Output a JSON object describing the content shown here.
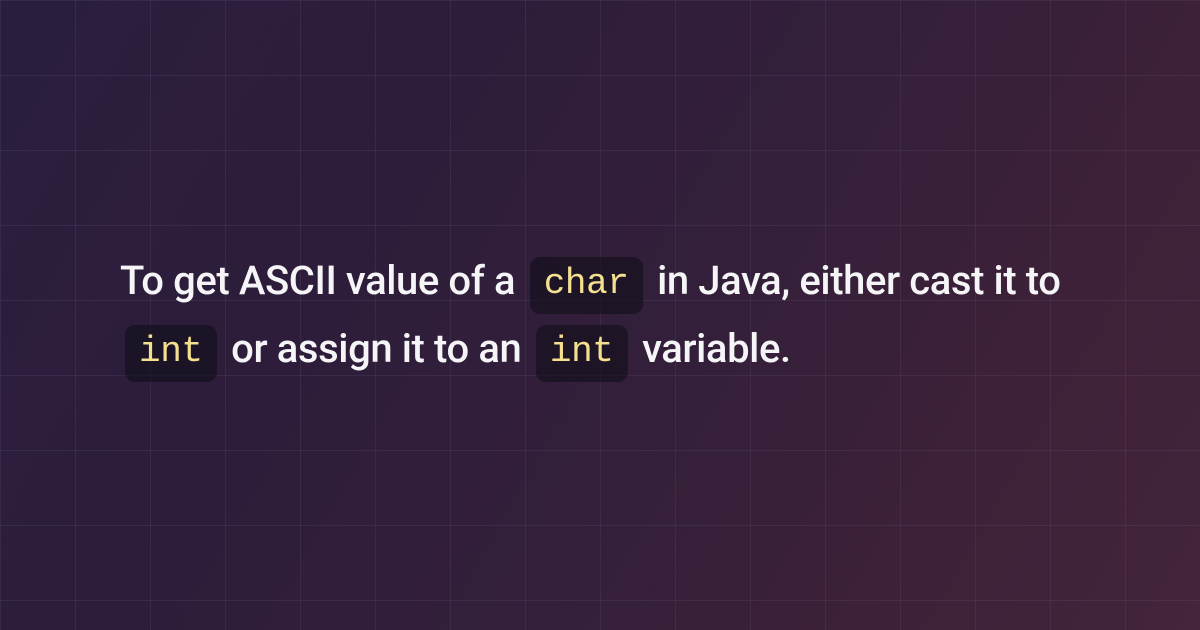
{
  "content": {
    "segments": {
      "text1": "To get ASCII value of a ",
      "code1": "char",
      "text2": " in Java, either cast it to ",
      "code2": "int",
      "text3": " or assign it to an ",
      "code3": "int",
      "text4": " variable."
    }
  },
  "colors": {
    "background_start": "#2a1e3f",
    "background_end": "#44253a",
    "text": "#f5f5f7",
    "code_bg": "rgba(18, 16, 28, 0.65)",
    "code_text": "#f5e08f",
    "grid_line": "rgba(120, 110, 150, 0.15)"
  }
}
